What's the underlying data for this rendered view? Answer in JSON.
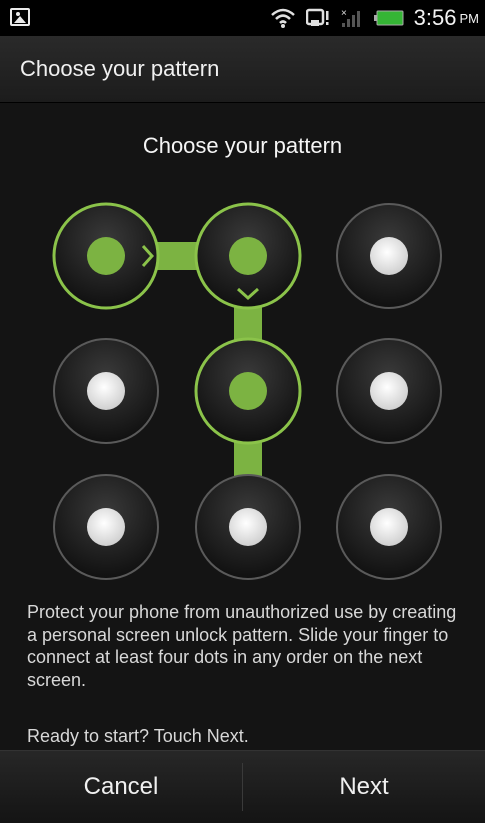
{
  "status_bar": {
    "time": "3:56",
    "ampm": "PM",
    "icons": [
      "gallery-icon",
      "wifi-icon",
      "sim-card-icon",
      "signal-icon",
      "battery-icon"
    ]
  },
  "title_bar": {
    "title": "Choose your pattern"
  },
  "content": {
    "heading": "Choose your pattern",
    "pattern": {
      "rows": 3,
      "cols": 3,
      "selected_path": [
        1,
        2,
        5
      ],
      "accent_color": "#8bc34a",
      "accent_fill": "#7cb342"
    },
    "description": "Protect your phone from unauthorized use by creating a personal screen unlock pattern. Slide your finger to connect at least four dots in any order on the next screen.",
    "ready": "Ready to start? Touch Next."
  },
  "bottom_bar": {
    "cancel": "Cancel",
    "next": "Next"
  }
}
